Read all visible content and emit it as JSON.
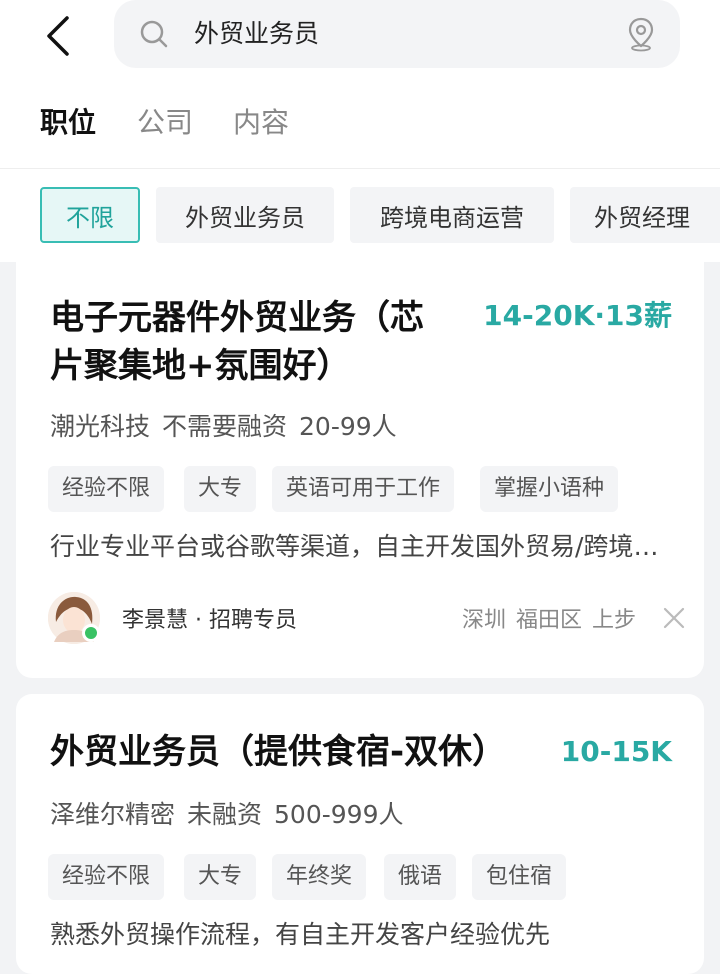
{
  "search": {
    "query": "外贸业务员"
  },
  "tabs": [
    {
      "label": "职位"
    },
    {
      "label": "公司"
    },
    {
      "label": "内容"
    }
  ],
  "filters": [
    {
      "label": "不限"
    },
    {
      "label": "外贸业务员"
    },
    {
      "label": "跨境电商运营"
    },
    {
      "label": "外贸经理"
    }
  ],
  "jobs": [
    {
      "title_line1": "电子元器件外贸业务（芯",
      "title_line2": "片聚集地+氛围好）",
      "salary": "14-20K·13薪",
      "company": "潮光科技",
      "funding": "不需要融资",
      "size": "20-99人",
      "tags": [
        "经验不限",
        "大专",
        "英语可用于工作",
        "掌握小语种"
      ],
      "description": "行业专业平台或谷歌等渠道，自主开发国外贸易/跨境电商客户",
      "recruiter": "李景慧 · 招聘专员",
      "city": "深圳",
      "district": "福田区",
      "area": "上步"
    },
    {
      "title_line1": "外贸业务员（提供食宿-双休）",
      "salary": "10-15K",
      "company": "泽维尔精密",
      "funding": "未融资",
      "size": "500-999人",
      "tags": [
        "经验不限",
        "大专",
        "年终奖",
        "俄语",
        "包住宿"
      ],
      "description": "熟悉外贸操作流程，有自主开发客户经验优先"
    }
  ],
  "colors": {
    "accent": "#29a9a3",
    "chip_active_border": "#38bdb4",
    "online": "#39c264"
  }
}
